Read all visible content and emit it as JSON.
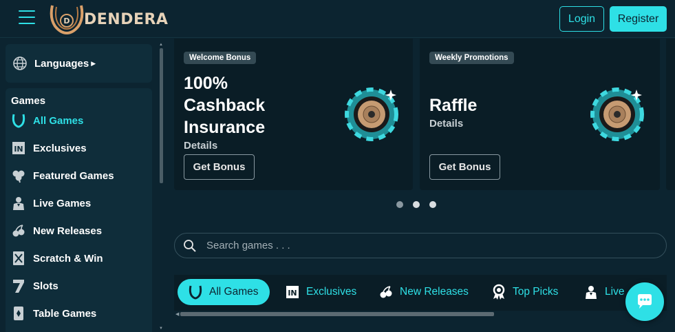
{
  "header": {
    "brand": "DENDERA",
    "login_label": "Login",
    "register_label": "Register"
  },
  "sidebar": {
    "languages_label": "Languages",
    "games_title": "Games",
    "items": [
      {
        "label": "All Games",
        "icon": "horseshoe-icon",
        "active": true
      },
      {
        "label": "Exclusives",
        "icon": "exclusive-icon",
        "active": false
      },
      {
        "label": "Featured Games",
        "icon": "clover-icon",
        "active": false
      },
      {
        "label": "Live Games",
        "icon": "dealer-icon",
        "active": false
      },
      {
        "label": "New Releases",
        "icon": "cherries-icon",
        "active": false
      },
      {
        "label": "Scratch & Win",
        "icon": "scratch-card-icon",
        "active": false
      },
      {
        "label": "Slots",
        "icon": "seven-icon",
        "active": false
      },
      {
        "label": "Table Games",
        "icon": "cards-icon",
        "active": false
      }
    ]
  },
  "promos": [
    {
      "badge": "Welcome Bonus",
      "title_lines": [
        "100%",
        "Cashback",
        "Insurance"
      ],
      "details": "Details",
      "button": "Get Bonus"
    },
    {
      "badge": "Weekly Promotions",
      "title_lines": [
        "Raffle"
      ],
      "details": "Details",
      "button": "Get Bonus"
    }
  ],
  "carousel": {
    "count": 3,
    "active": 0
  },
  "search": {
    "placeholder": "Search games . . ."
  },
  "tabs": [
    {
      "label": "All Games",
      "icon": "horseshoe-icon",
      "active": true
    },
    {
      "label": "Exclusives",
      "icon": "exclusive-icon",
      "active": false
    },
    {
      "label": "New Releases",
      "icon": "cherries-icon",
      "active": false
    },
    {
      "label": "Top Picks",
      "icon": "award-icon",
      "active": false
    },
    {
      "label": "Live",
      "icon": "dealer-icon",
      "active": false
    }
  ],
  "colors": {
    "accent": "#2ee0e6",
    "background": "#0c2430",
    "panel": "#0f2d3a"
  }
}
